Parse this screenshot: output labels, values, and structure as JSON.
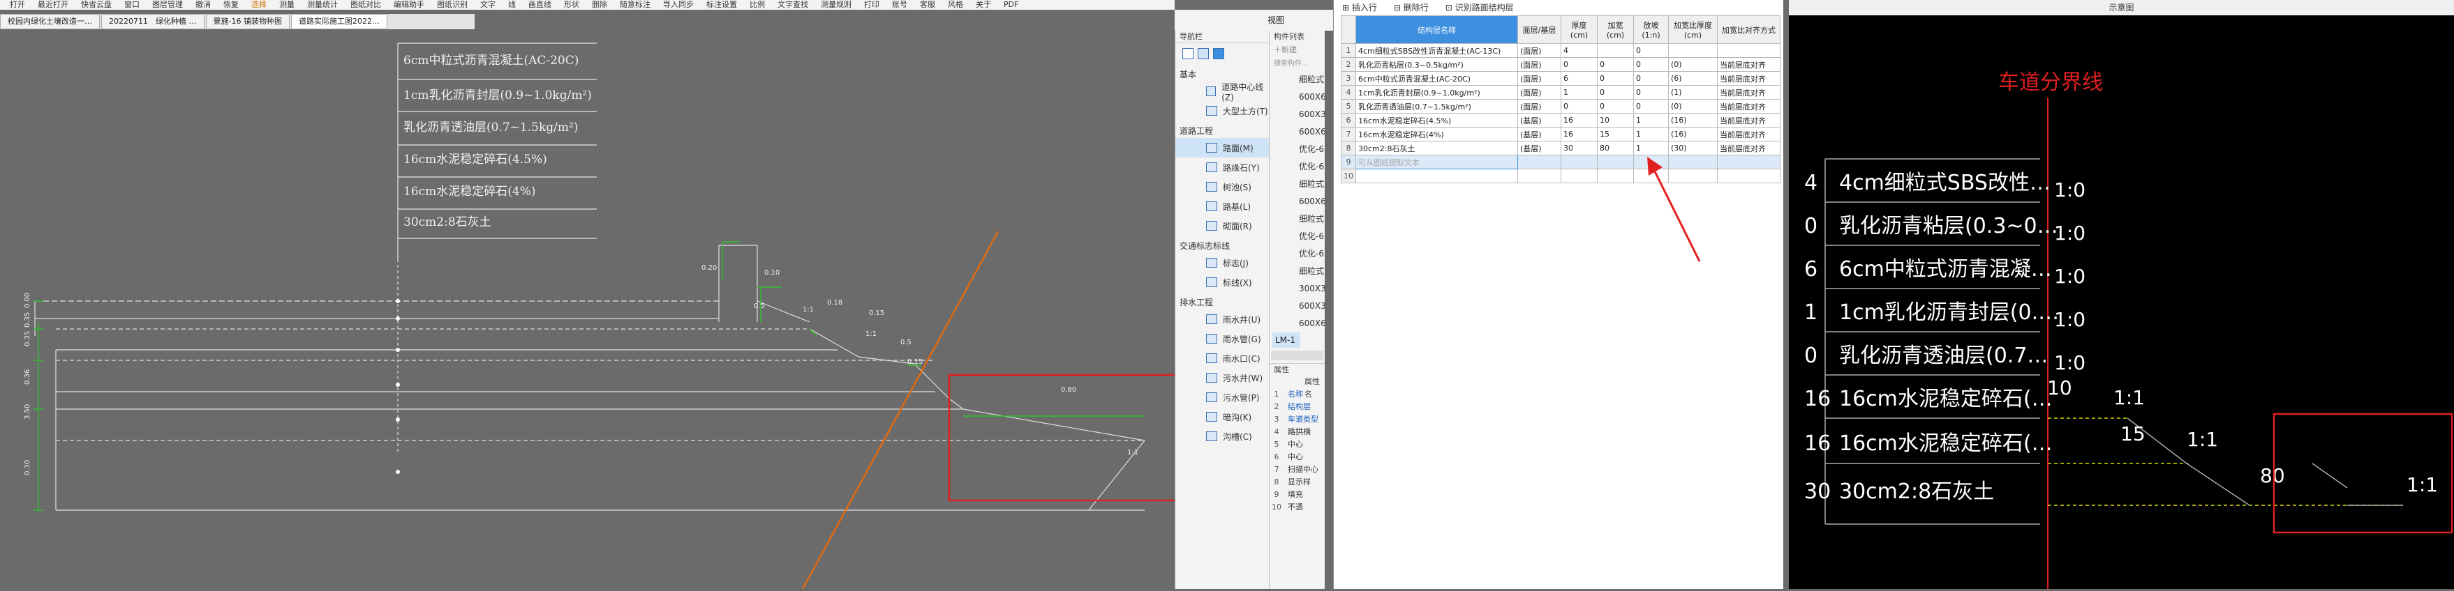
{
  "menubar": {
    "items": [
      {
        "label": "打开",
        "orange": false
      },
      {
        "label": "最近打开",
        "orange": false
      },
      {
        "label": "快省云盘",
        "orange": false
      },
      {
        "label": "窗口",
        "orange": false
      },
      {
        "label": "图层管理",
        "orange": false
      },
      {
        "label": "撤消",
        "orange": false
      },
      {
        "label": "恢复",
        "orange": false
      },
      {
        "label": "选择",
        "orange": true
      },
      {
        "label": "测量",
        "orange": false
      },
      {
        "label": "测量统计",
        "orange": false
      },
      {
        "label": "图纸对比",
        "orange": false
      },
      {
        "label": "编辑助手",
        "orange": false
      },
      {
        "label": "图纸识别",
        "orange": false
      },
      {
        "label": "文字",
        "orange": false
      },
      {
        "label": "线",
        "orange": false
      },
      {
        "label": "画直线",
        "orange": false
      },
      {
        "label": "形状",
        "orange": false
      },
      {
        "label": "删除",
        "orange": false
      },
      {
        "label": "随意标注",
        "orange": false
      },
      {
        "label": "导入同步",
        "orange": false
      },
      {
        "label": "标注设置",
        "orange": false
      },
      {
        "label": "比例",
        "orange": false
      },
      {
        "label": "文字查找",
        "orange": false
      },
      {
        "label": "测量规则",
        "orange": false
      },
      {
        "label": "打印",
        "orange": false
      },
      {
        "label": "账号",
        "orange": false
      },
      {
        "label": "客服",
        "orange": false
      },
      {
        "label": "风格",
        "orange": false
      },
      {
        "label": "关于",
        "orange": false
      },
      {
        "label": "PDF",
        "orange": false
      }
    ]
  },
  "tabs": [
    {
      "label": "校园内绿化土壤改造一…",
      "active": false
    },
    {
      "label": "20220711　绿化种植 …",
      "active": false
    },
    {
      "label": "景施-16 铺装物种图",
      "active": false
    },
    {
      "label": "道路实际施工图2022…",
      "active": true
    }
  ],
  "cad": {
    "table_rows": [
      "6cm中粒式沥青混凝土(AC-20C)",
      "1cm乳化沥青封层(0.9~1.0kg/m²)",
      "乳化沥青透油层(0.7~1.5kg/m²)",
      "16cm水泥稳定碎石(4.5%)",
      "16cm水泥稳定碎石(4%)",
      "30cm2:8石灰土"
    ],
    "dims_left": [
      "0.00",
      "0.35",
      "0.35",
      "0.36",
      "3.50",
      "0.30"
    ],
    "dims_right": [
      "0.20",
      "0.10",
      "0.5",
      "0.18",
      "1:1",
      "0.15",
      "1:1",
      "0.5",
      "0.80",
      "1:1",
      "0.15"
    ]
  },
  "view_label": "视图",
  "navpanel": {
    "header": "导航栏",
    "group_basic": "基本",
    "basic_items": [
      {
        "label": "道路中心线(Z)",
        "selected": false
      },
      {
        "label": "大型土方(T)",
        "selected": false
      }
    ],
    "group_road": "道路工程",
    "road_items": [
      {
        "label": "路面(M)",
        "selected": true
      },
      {
        "label": "路缘石(Y)",
        "selected": false
      },
      {
        "label": "树池(S)",
        "selected": false
      },
      {
        "label": "路基(L)",
        "selected": false
      },
      {
        "label": "砌面(R)",
        "selected": false
      }
    ],
    "group_traffic": "交通标志标线",
    "traffic_items": [
      {
        "label": "标志(J)",
        "selected": false
      },
      {
        "label": "标线(X)",
        "selected": false
      }
    ],
    "group_drain": "排水工程",
    "drain_items": [
      {
        "label": "雨水井(U)",
        "selected": false
      },
      {
        "label": "雨水管(G)",
        "selected": false
      },
      {
        "label": "雨水口(C)",
        "selected": false
      },
      {
        "label": "污水井(W)",
        "selected": false
      },
      {
        "label": "污水管(P)",
        "selected": false
      },
      {
        "label": "暗沟(K)",
        "selected": false
      },
      {
        "label": "沟槽(C)",
        "selected": false
      }
    ]
  },
  "constpanel": {
    "header": "构件列表",
    "new_label": "新建",
    "search_placeholder": "搜索构件...",
    "items": [
      "细粒式",
      "600X6",
      "600X3",
      "600X6",
      "优化-6",
      "优化-6",
      "细粒式",
      "600X6",
      "细粒式",
      "优化-6",
      "优化-6",
      "细粒式",
      "300X3",
      "600X3",
      "600X6"
    ],
    "selected_item": "LM-1",
    "props_header": "属性",
    "props_title": "属性名",
    "props": [
      {
        "num": "1",
        "label": "名称"
      },
      {
        "num": "2",
        "label": "结构层"
      },
      {
        "num": "3",
        "label": "车道类型"
      },
      {
        "num": "4",
        "label": "路拱横"
      },
      {
        "num": "5",
        "label": "中心"
      },
      {
        "num": "6",
        "label": "中心"
      },
      {
        "num": "7",
        "label": "扫描中心"
      },
      {
        "num": "8",
        "label": "显示样"
      },
      {
        "num": "9",
        "label": "填充"
      },
      {
        "num": "10",
        "label": "不透"
      }
    ]
  },
  "tablepanel": {
    "toolbar": [
      "插入行",
      "删除行",
      "识别路面结构层"
    ],
    "headers": [
      "结构层名称",
      "面层/基层",
      "厚度(cm)",
      "加宽(cm)",
      "放坡(1:n)",
      "加宽比厚度(cm)",
      "加宽比对齐方式"
    ],
    "rows": [
      {
        "num": "1",
        "name": "4cm细粒式SBS改性沥青混凝土(AC-13C)",
        "type": "(面层)",
        "thick": "4",
        "widen": "",
        "slope": "0",
        "ratio": "",
        "align": ""
      },
      {
        "num": "2",
        "name": "乳化沥青粘层(0.3~0.5kg/m²)",
        "type": "(面层)",
        "thick": "0",
        "widen": "0",
        "slope": "0",
        "ratio": "(0)",
        "align": "当前层底对齐"
      },
      {
        "num": "3",
        "name": "6cm中粒式沥青混凝土(AC-20C)",
        "type": "(面层)",
        "thick": "6",
        "widen": "0",
        "slope": "0",
        "ratio": "(6)",
        "align": "当前层底对齐"
      },
      {
        "num": "4",
        "name": "1cm乳化沥青封层(0.9~1.0kg/m²)",
        "type": "(面层)",
        "thick": "1",
        "widen": "0",
        "slope": "0",
        "ratio": "(1)",
        "align": "当前层底对齐"
      },
      {
        "num": "5",
        "name": "乳化沥青透油层(0.7~1.5kg/m²)",
        "type": "(面层)",
        "thick": "0",
        "widen": "0",
        "slope": "0",
        "ratio": "(0)",
        "align": "当前层底对齐"
      },
      {
        "num": "6",
        "name": "16cm水泥稳定碎石(4.5%)",
        "type": "(基层)",
        "thick": "16",
        "widen": "10",
        "slope": "1",
        "ratio": "(16)",
        "align": "当前层底对齐"
      },
      {
        "num": "7",
        "name": "16cm水泥稳定碎石(4%)",
        "type": "(基层)",
        "thick": "16",
        "widen": "15",
        "slope": "1",
        "ratio": "(16)",
        "align": "当前层底对齐"
      },
      {
        "num": "8",
        "name": "30cm2:8石灰土",
        "type": "(基层)",
        "thick": "30",
        "widen": "80",
        "slope": "1",
        "ratio": "(30)",
        "align": "当前层底对齐"
      },
      {
        "num": "9",
        "name": "",
        "type": "",
        "thick": "",
        "widen": "",
        "slope": "",
        "ratio": "",
        "align": ""
      },
      {
        "num": "10",
        "name": "",
        "type": "",
        "thick": "",
        "widen": "",
        "slope": "",
        "ratio": "",
        "align": ""
      }
    ],
    "input_placeholder": "可从图纸提取文本"
  },
  "preview": {
    "title": "示意图",
    "lane_boundary": "车道分界线",
    "layers": [
      {
        "thick": "4",
        "name": "4cm细粒式SBS改性…",
        "slope": "1:0"
      },
      {
        "thick": "0",
        "name": "乳化沥青粘层(0.3~0…",
        "slope": "1:0"
      },
      {
        "thick": "6",
        "name": "6cm中粒式沥青混凝…",
        "slope": "1:0"
      },
      {
        "thick": "1",
        "name": "1cm乳化沥青封层(0.…",
        "slope": "1:0"
      },
      {
        "thick": "0",
        "name": "乳化沥青透油层(0.7…",
        "slope": "1:0"
      },
      {
        "thick": "16",
        "name": "16cm水泥稳定碎石(…",
        "slope": "1:1"
      },
      {
        "thick": "16",
        "name": "16cm水泥稳定碎石(…",
        "slope": "1:1"
      },
      {
        "thick": "30",
        "name": "30cm2:8石灰土",
        "slope": "1:1"
      }
    ],
    "widen_labels": [
      "10",
      "15",
      "80"
    ]
  },
  "colors": {
    "accent": "#3d8fe0",
    "red": "#e02020",
    "orange_line": "#e06a10",
    "cad_bg": "#6b6b6b",
    "green": "#2fbf2f"
  }
}
